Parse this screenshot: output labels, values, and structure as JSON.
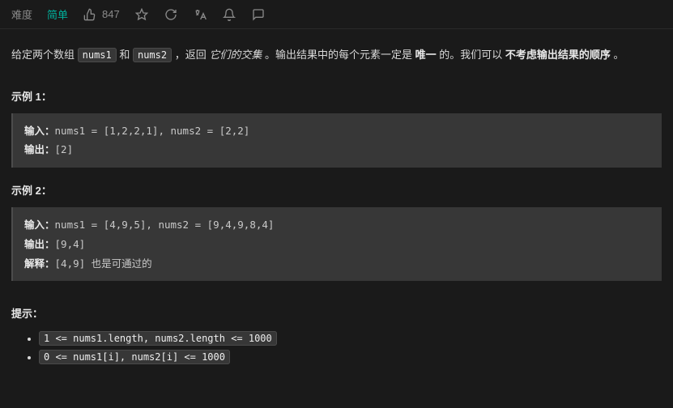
{
  "header": {
    "difficulty_label": "难度",
    "difficulty_value": "简单",
    "likes": "847"
  },
  "description": {
    "t1": "给定两个数组 ",
    "c1": "nums1",
    "t2": " 和 ",
    "c2": "nums2",
    "t3": " ，返回 ",
    "em": "它们的交集",
    "t4": " 。输出结果中的每个元素一定是 ",
    "b1": "唯一",
    "t5": " 的。我们可以 ",
    "b2": "不考虑输出结果的顺序",
    "t6": " 。"
  },
  "examples": [
    {
      "title": "示例 1：",
      "input_label": "输入：",
      "input_value": "nums1 = [1,2,2,1], nums2 = [2,2]",
      "output_label": "输出：",
      "output_value": "[2]",
      "explain_label": "",
      "explain_value": ""
    },
    {
      "title": "示例 2：",
      "input_label": "输入：",
      "input_value": "nums1 = [4,9,5], nums2 = [9,4,9,8,4]",
      "output_label": "输出：",
      "output_value": "[9,4]",
      "explain_label": "解释：",
      "explain_value": "[4,9] 也是可通过的"
    }
  ],
  "hints": {
    "title": "提示：",
    "items": [
      "1 <= nums1.length, nums2.length <= 1000",
      "0 <= nums1[i], nums2[i] <= 1000"
    ]
  }
}
